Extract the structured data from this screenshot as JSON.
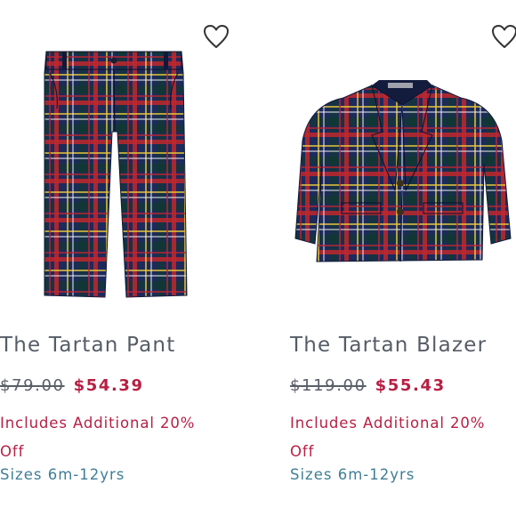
{
  "products": [
    {
      "name": "The Tartan Pant",
      "original_price": "$79.00",
      "sale_price": "$54.39",
      "promo": "Includes Additional 20% Off",
      "sizes": "Sizes 6m-12yrs",
      "image_icon": "tartan-pant-image",
      "wishlist_icon": "heart-outline-icon"
    },
    {
      "name": "The Tartan Blazer",
      "original_price": "$119.00",
      "sale_price": "$55.43",
      "promo": "Includes Additional 20% Off",
      "sizes": "Sizes 6m-12yrs",
      "image_icon": "tartan-blazer-image",
      "wishlist_icon": "heart-outline-icon"
    }
  ],
  "colors": {
    "sale": "#b71f43",
    "title": "#555c66",
    "sizes": "#3f7e97",
    "tartan_navy": "#1c2a5c",
    "tartan_red": "#c0272d"
  }
}
